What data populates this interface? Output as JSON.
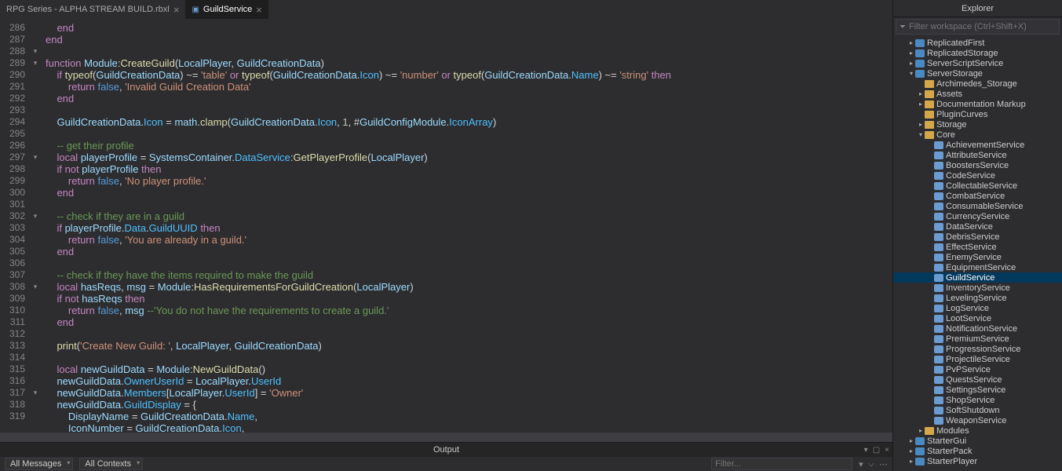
{
  "tabs": [
    {
      "label": "RPG Series - ALPHA STREAM BUILD.rbxl",
      "close": "×",
      "active": false
    },
    {
      "label": "GuildService",
      "close": "×",
      "active": true
    }
  ],
  "lines_start": 286,
  "lines_end": 319,
  "fold_marks": {
    "288": "▾",
    "289": "▾",
    "297": "▾",
    "302": "▾",
    "308": "▾",
    "317": "▾"
  },
  "explorer": {
    "title": "Explorer",
    "filter_placeholder": "Filter workspace (Ctrl+Shift+X)",
    "top": [
      {
        "label": "ReplicatedFirst",
        "chev": "▸",
        "icon": "service",
        "indent": 1
      },
      {
        "label": "ReplicatedStorage",
        "chev": "▸",
        "icon": "service",
        "indent": 1
      },
      {
        "label": "ServerScriptService",
        "chev": "▸",
        "icon": "service",
        "indent": 1
      },
      {
        "label": "ServerStorage",
        "chev": "▾",
        "icon": "service",
        "indent": 1
      },
      {
        "label": "Archimedes_Storage",
        "chev": "",
        "icon": "folder",
        "indent": 2
      },
      {
        "label": "Assets",
        "chev": "▸",
        "icon": "folder",
        "indent": 2
      },
      {
        "label": "Documentation Markup",
        "chev": "▸",
        "icon": "folder",
        "indent": 2
      },
      {
        "label": "PluginCurves",
        "chev": "",
        "icon": "folder",
        "indent": 2
      },
      {
        "label": "Storage",
        "chev": "▸",
        "icon": "folder",
        "indent": 2
      },
      {
        "label": "Core",
        "chev": "▾",
        "icon": "folder",
        "indent": 2
      }
    ],
    "core": [
      "AchievementService",
      "AttributeService",
      "BoostersService",
      "CodeService",
      "CollectableService",
      "CombatService",
      "ConsumableService",
      "CurrencyService",
      "DataService",
      "DebrisService",
      "EffectService",
      "EnemyService",
      "EquipmentService",
      "GuildService",
      "InventoryService",
      "LevelingService",
      "LogService",
      "LootService",
      "NotificationService",
      "PremiumService",
      "ProgressionService",
      "ProjectileService",
      "PvPService",
      "QuestsService",
      "SettingsService",
      "ShopService",
      "SoftShutdown",
      "WeaponService"
    ],
    "selected": "GuildService",
    "after_core": [
      {
        "label": "Modules",
        "chev": "▸",
        "icon": "folder",
        "indent": 2
      },
      {
        "label": "StarterGui",
        "chev": "▸",
        "icon": "service",
        "indent": 1
      },
      {
        "label": "StarterPack",
        "chev": "▸",
        "icon": "service",
        "indent": 1
      },
      {
        "label": "StarterPlayer",
        "chev": "▸",
        "icon": "service",
        "indent": 1
      }
    ]
  },
  "output": {
    "title": "Output",
    "all_messages": "All Messages",
    "all_contexts": "All Contexts",
    "filter_placeholder": "Filter..."
  }
}
